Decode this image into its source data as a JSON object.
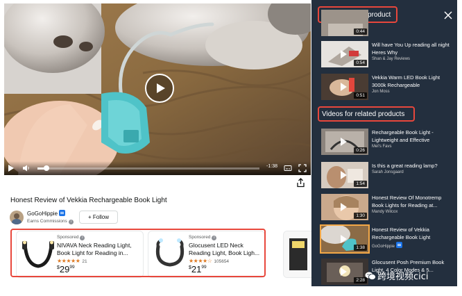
{
  "player": {
    "time_remaining": "-1:38",
    "progress_fraction": 0.04
  },
  "video": {
    "title": "Honest Review of Vekkia Rechargeable Book Light",
    "channel_name": "GoGoHippie",
    "earns": "Earns Commissions",
    "follow_label": "+ Follow"
  },
  "products": [
    {
      "sponsored": "Sponsored",
      "title": "NIVAVA Neck Reading Light, Book Light for Reading in...",
      "rating_count": "21",
      "rating": 4.5,
      "price_symbol": "$",
      "price_whole": "29",
      "price_cents": "99"
    },
    {
      "sponsored": "Sponsored",
      "title": "Glocusent LED Neck Reading Light, Book Ligh...",
      "rating_count": "105654",
      "rating": 4.5,
      "price_symbol": "$",
      "price_whole": "21",
      "price_cents": "99"
    }
  ],
  "panel": {
    "section1_title": "Videos for this product",
    "section2_title": "Videos for related products",
    "items": [
      {
        "title": "",
        "sub": "",
        "duration": "0:44"
      },
      {
        "title": "Will have You Up reading all night Heres Why",
        "sub": "Shan & Jay Reviews",
        "duration": "0:54"
      },
      {
        "title": "Vekkia Warm LED Book Light 3000k Rechargeable",
        "sub": "Jon Moss",
        "duration": "0:51"
      },
      {
        "title": "Rechargeable Book Light - Lightweight and Effective",
        "sub": "Mel's Favs",
        "duration": "0:26"
      },
      {
        "title": "Is this a great reading lamp?",
        "sub": "Sarah Jonsgaard",
        "duration": "1:54"
      },
      {
        "title": "Honest Review Of Monotremp Book Lights for Reading at...",
        "sub": "Mandy Wilcox",
        "duration": "1:30"
      },
      {
        "title": "Honest Review of Vekkia Rechargeable Book Light",
        "sub": "GoGoHippie",
        "duration": "1:38"
      },
      {
        "title": "Glocusent Posh Premium Book Light, 4 Color Modes & 5...",
        "sub": "",
        "duration": "2:28"
      }
    ]
  },
  "watermark": "跨境视频cici",
  "colors": {
    "panel_bg": "#232f3e",
    "highlight": "#e8473c",
    "star": "#de7921",
    "active_outline": "#f3a847"
  }
}
